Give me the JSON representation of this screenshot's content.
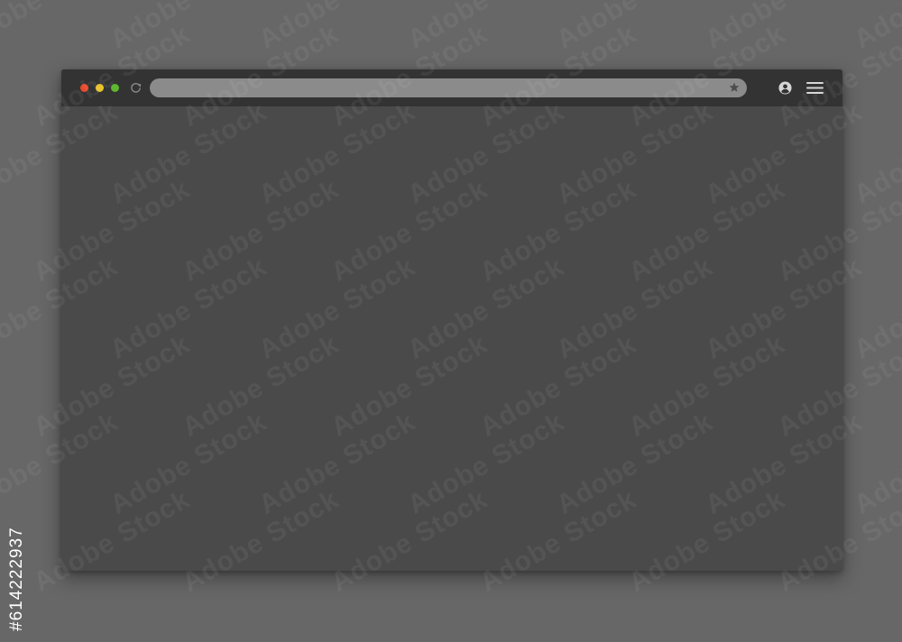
{
  "page": {
    "background_color": "#676767"
  },
  "browser": {
    "frame_color": "#333333",
    "content_color": "#4a4a4a",
    "traffic_lights": [
      {
        "name": "close",
        "color": "#e8492a"
      },
      {
        "name": "minimize",
        "color": "#e9c22a"
      },
      {
        "name": "maximize",
        "color": "#5fb630"
      }
    ],
    "reload_icon": {
      "icon": "reload-icon",
      "color": "#8a8a8a"
    },
    "address_bar": {
      "value": "",
      "placeholder": "",
      "background": "#8b8b8b"
    },
    "bookmark_icon": {
      "icon": "star-icon",
      "color": "#4c4c4c"
    },
    "account_icon": {
      "icon": "account-icon",
      "color": "#d6d6d6"
    },
    "menu_icon": {
      "icon": "hamburger-menu-icon",
      "color": "#d6d6d6"
    }
  },
  "watermark": {
    "text": "Adobe Stock",
    "stock_id": "#614222937",
    "stock_id_color": "#ffffff"
  }
}
